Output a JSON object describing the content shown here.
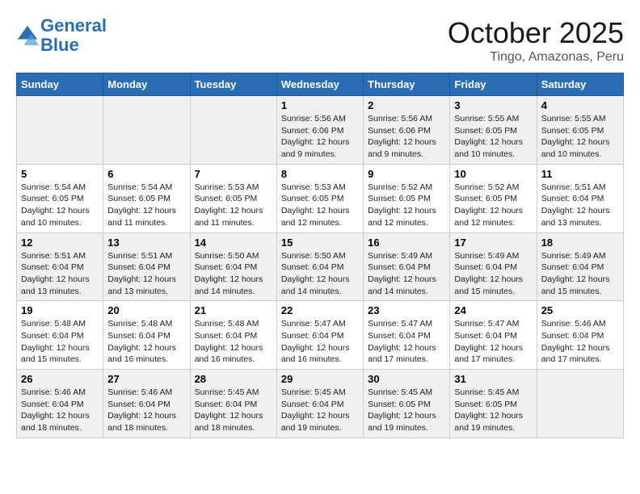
{
  "header": {
    "logo_line1": "General",
    "logo_line2": "Blue",
    "month": "October 2025",
    "location": "Tingo, Amazonas, Peru"
  },
  "weekdays": [
    "Sunday",
    "Monday",
    "Tuesday",
    "Wednesday",
    "Thursday",
    "Friday",
    "Saturday"
  ],
  "weeks": [
    [
      {
        "day": "",
        "text": ""
      },
      {
        "day": "",
        "text": ""
      },
      {
        "day": "",
        "text": ""
      },
      {
        "day": "1",
        "text": "Sunrise: 5:56 AM\nSunset: 6:06 PM\nDaylight: 12 hours\nand 9 minutes."
      },
      {
        "day": "2",
        "text": "Sunrise: 5:56 AM\nSunset: 6:06 PM\nDaylight: 12 hours\nand 9 minutes."
      },
      {
        "day": "3",
        "text": "Sunrise: 5:55 AM\nSunset: 6:05 PM\nDaylight: 12 hours\nand 10 minutes."
      },
      {
        "day": "4",
        "text": "Sunrise: 5:55 AM\nSunset: 6:05 PM\nDaylight: 12 hours\nand 10 minutes."
      }
    ],
    [
      {
        "day": "5",
        "text": "Sunrise: 5:54 AM\nSunset: 6:05 PM\nDaylight: 12 hours\nand 10 minutes."
      },
      {
        "day": "6",
        "text": "Sunrise: 5:54 AM\nSunset: 6:05 PM\nDaylight: 12 hours\nand 11 minutes."
      },
      {
        "day": "7",
        "text": "Sunrise: 5:53 AM\nSunset: 6:05 PM\nDaylight: 12 hours\nand 11 minutes."
      },
      {
        "day": "8",
        "text": "Sunrise: 5:53 AM\nSunset: 6:05 PM\nDaylight: 12 hours\nand 12 minutes."
      },
      {
        "day": "9",
        "text": "Sunrise: 5:52 AM\nSunset: 6:05 PM\nDaylight: 12 hours\nand 12 minutes."
      },
      {
        "day": "10",
        "text": "Sunrise: 5:52 AM\nSunset: 6:05 PM\nDaylight: 12 hours\nand 12 minutes."
      },
      {
        "day": "11",
        "text": "Sunrise: 5:51 AM\nSunset: 6:04 PM\nDaylight: 12 hours\nand 13 minutes."
      }
    ],
    [
      {
        "day": "12",
        "text": "Sunrise: 5:51 AM\nSunset: 6:04 PM\nDaylight: 12 hours\nand 13 minutes."
      },
      {
        "day": "13",
        "text": "Sunrise: 5:51 AM\nSunset: 6:04 PM\nDaylight: 12 hours\nand 13 minutes."
      },
      {
        "day": "14",
        "text": "Sunrise: 5:50 AM\nSunset: 6:04 PM\nDaylight: 12 hours\nand 14 minutes."
      },
      {
        "day": "15",
        "text": "Sunrise: 5:50 AM\nSunset: 6:04 PM\nDaylight: 12 hours\nand 14 minutes."
      },
      {
        "day": "16",
        "text": "Sunrise: 5:49 AM\nSunset: 6:04 PM\nDaylight: 12 hours\nand 14 minutes."
      },
      {
        "day": "17",
        "text": "Sunrise: 5:49 AM\nSunset: 6:04 PM\nDaylight: 12 hours\nand 15 minutes."
      },
      {
        "day": "18",
        "text": "Sunrise: 5:49 AM\nSunset: 6:04 PM\nDaylight: 12 hours\nand 15 minutes."
      }
    ],
    [
      {
        "day": "19",
        "text": "Sunrise: 5:48 AM\nSunset: 6:04 PM\nDaylight: 12 hours\nand 15 minutes."
      },
      {
        "day": "20",
        "text": "Sunrise: 5:48 AM\nSunset: 6:04 PM\nDaylight: 12 hours\nand 16 minutes."
      },
      {
        "day": "21",
        "text": "Sunrise: 5:48 AM\nSunset: 6:04 PM\nDaylight: 12 hours\nand 16 minutes."
      },
      {
        "day": "22",
        "text": "Sunrise: 5:47 AM\nSunset: 6:04 PM\nDaylight: 12 hours\nand 16 minutes."
      },
      {
        "day": "23",
        "text": "Sunrise: 5:47 AM\nSunset: 6:04 PM\nDaylight: 12 hours\nand 17 minutes."
      },
      {
        "day": "24",
        "text": "Sunrise: 5:47 AM\nSunset: 6:04 PM\nDaylight: 12 hours\nand 17 minutes."
      },
      {
        "day": "25",
        "text": "Sunrise: 5:46 AM\nSunset: 6:04 PM\nDaylight: 12 hours\nand 17 minutes."
      }
    ],
    [
      {
        "day": "26",
        "text": "Sunrise: 5:46 AM\nSunset: 6:04 PM\nDaylight: 12 hours\nand 18 minutes."
      },
      {
        "day": "27",
        "text": "Sunrise: 5:46 AM\nSunset: 6:04 PM\nDaylight: 12 hours\nand 18 minutes."
      },
      {
        "day": "28",
        "text": "Sunrise: 5:45 AM\nSunset: 6:04 PM\nDaylight: 12 hours\nand 18 minutes."
      },
      {
        "day": "29",
        "text": "Sunrise: 5:45 AM\nSunset: 6:04 PM\nDaylight: 12 hours\nand 19 minutes."
      },
      {
        "day": "30",
        "text": "Sunrise: 5:45 AM\nSunset: 6:05 PM\nDaylight: 12 hours\nand 19 minutes."
      },
      {
        "day": "31",
        "text": "Sunrise: 5:45 AM\nSunset: 6:05 PM\nDaylight: 12 hours\nand 19 minutes."
      },
      {
        "day": "",
        "text": ""
      }
    ]
  ]
}
